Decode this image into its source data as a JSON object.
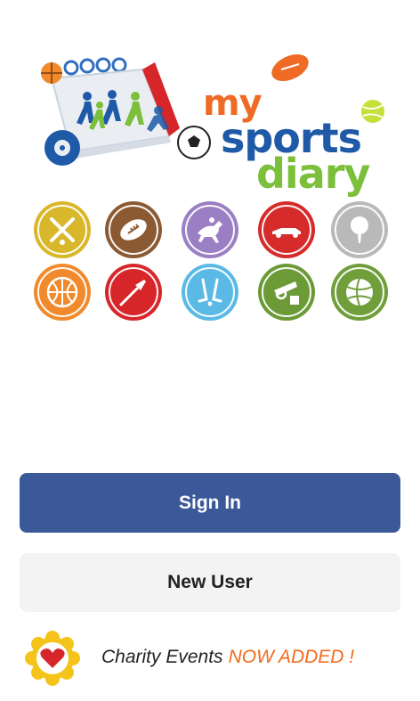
{
  "logo": {
    "word_my": "my",
    "word_sports": "sports",
    "word_diary": "diary",
    "colors": {
      "my": "#ef6a24",
      "sports": "#1e5aa8",
      "diary": "#7cbf3a"
    }
  },
  "sports": [
    {
      "name": "cricket",
      "icon": "cricket-bats-icon",
      "color": "#d9b72a"
    },
    {
      "name": "american-football",
      "icon": "football-icon",
      "color": "#8b5a33"
    },
    {
      "name": "horse-racing",
      "icon": "horse-racing-icon",
      "color": "#9b7fc4"
    },
    {
      "name": "motor-racing",
      "icon": "race-car-icon",
      "color": "#d62b2b"
    },
    {
      "name": "golf",
      "icon": "golf-ball-icon",
      "color": "#b9b9b9"
    },
    {
      "name": "basketball",
      "icon": "basketball-icon",
      "color": "#f08a2c"
    },
    {
      "name": "darts",
      "icon": "dart-icon",
      "color": "#d7262a"
    },
    {
      "name": "hockey",
      "icon": "hockey-sticks-icon",
      "color": "#5ab9e5"
    },
    {
      "name": "fishing",
      "icon": "fishing-reel-icon",
      "color": "#6b9a37"
    },
    {
      "name": "volleyball",
      "icon": "volleyball-icon",
      "color": "#6f9e3a"
    }
  ],
  "buttons": {
    "signin_label": "Sign In",
    "signin_color": "#3b5998",
    "newuser_label": "New User"
  },
  "charity": {
    "lead": "Charity Events",
    "highlight": "NOW ADDED !",
    "highlight_color": "#f26b1d",
    "badge_icon": "heart-badge-icon"
  }
}
